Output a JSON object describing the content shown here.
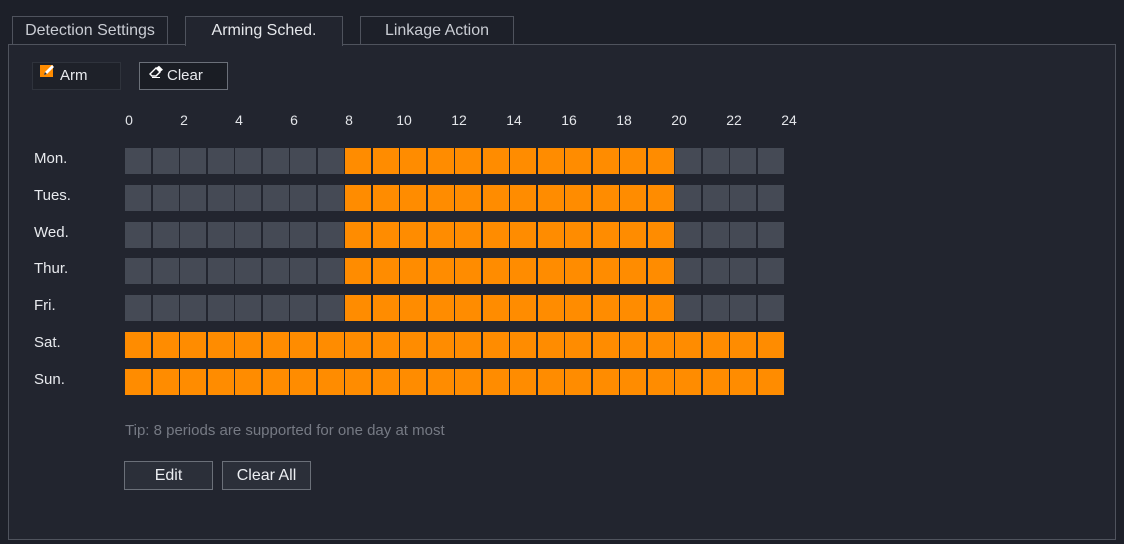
{
  "tabs": [
    {
      "label": "Detection Settings",
      "active": false
    },
    {
      "label": "Arming Sched.",
      "active": true
    },
    {
      "label": "Linkage Action",
      "active": false
    }
  ],
  "toolbar": {
    "arm_label": "Arm",
    "arm_icon": "pencil-icon",
    "clear_label": "Clear",
    "clear_icon": "eraser-icon"
  },
  "schedule": {
    "hour_labels": [
      "0",
      "2",
      "4",
      "6",
      "8",
      "10",
      "12",
      "14",
      "16",
      "18",
      "20",
      "22",
      "24"
    ],
    "days": [
      {
        "label": "Mon.",
        "armed": [
          [
            8,
            20
          ]
        ]
      },
      {
        "label": "Tues.",
        "armed": [
          [
            8,
            20
          ]
        ]
      },
      {
        "label": "Wed.",
        "armed": [
          [
            8,
            20
          ]
        ]
      },
      {
        "label": "Thur.",
        "armed": [
          [
            8,
            20
          ]
        ]
      },
      {
        "label": "Fri.",
        "armed": [
          [
            8,
            20
          ]
        ]
      },
      {
        "label": "Sat.",
        "armed": [
          [
            0,
            24
          ]
        ]
      },
      {
        "label": "Sun.",
        "armed": [
          [
            0,
            24
          ]
        ]
      }
    ],
    "colors": {
      "armed": "#ff8c00",
      "unarmed": "#454a55"
    }
  },
  "tip": "Tip: 8 periods are supported for one day at most",
  "actions": {
    "edit_label": "Edit",
    "clear_all_label": "Clear All"
  }
}
